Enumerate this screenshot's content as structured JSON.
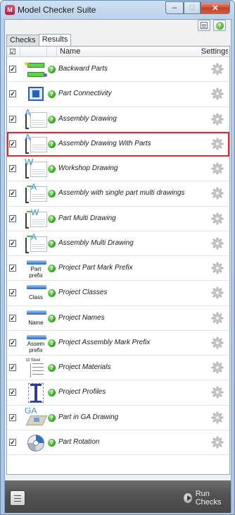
{
  "window": {
    "title": "Model Checker Suite",
    "minimize_glyph": "–",
    "maximize_glyph": "□",
    "close_glyph": "✕"
  },
  "toolbar": {
    "help_glyph": "?"
  },
  "tabs": [
    {
      "label": "Checks",
      "active": false
    },
    {
      "label": "Results",
      "active": true
    }
  ],
  "grid": {
    "header": {
      "check_glyph": "☑",
      "name": "Name",
      "settings": "Settings"
    },
    "check_glyph": "✓",
    "status_glyph": "?",
    "rows": [
      {
        "name": "Backward Parts",
        "checked": true,
        "icon": "backward-parts-icon",
        "selected": false
      },
      {
        "name": "Part Connectivity",
        "checked": true,
        "icon": "part-connectivity-icon",
        "selected": false
      },
      {
        "name": "Assembly Drawing",
        "checked": true,
        "icon": "assembly-drawing-icon",
        "letter": "A",
        "selected": false
      },
      {
        "name": "Assembly Drawing With Parts",
        "checked": true,
        "icon": "assembly-drawing-with-parts-icon",
        "letter": "A",
        "selected": true
      },
      {
        "name": "Workshop Drawing",
        "checked": true,
        "icon": "workshop-drawing-icon",
        "letter": "W",
        "selected": false
      },
      {
        "name": "Assembly with single part multi drawings",
        "checked": true,
        "icon": "assembly-single-part-multi-icon",
        "letter": "A",
        "selected": false
      },
      {
        "name": "Part Multi Drawing",
        "checked": true,
        "icon": "part-multi-drawing-icon",
        "letter": "W",
        "selected": false
      },
      {
        "name": "Assembly Multi Drawing",
        "checked": true,
        "icon": "assembly-multi-drawing-icon",
        "letter": "A",
        "selected": false
      },
      {
        "name": "Project Part Mark Prefix",
        "checked": true,
        "icon": "project-part-mark-prefix-icon",
        "caption": "Part\nprefix",
        "selected": false
      },
      {
        "name": "Project Classes",
        "checked": true,
        "icon": "project-classes-icon",
        "caption": "Class",
        "selected": false
      },
      {
        "name": "Project Names",
        "checked": true,
        "icon": "project-names-icon",
        "caption": "Name",
        "selected": false
      },
      {
        "name": "Project Assembly Mark Prefix",
        "checked": true,
        "icon": "project-assembly-mark-prefix-icon",
        "caption": "Assem\nprefix",
        "selected": false
      },
      {
        "name": "Project Materials",
        "checked": true,
        "icon": "project-materials-icon",
        "selected": false
      },
      {
        "name": "Project Profiles",
        "checked": true,
        "icon": "project-profiles-icon",
        "selected": false
      },
      {
        "name": "Part in GA Drawing",
        "checked": true,
        "icon": "part-in-ga-drawing-icon",
        "letter": "GA",
        "selected": false
      },
      {
        "name": "Part Rotation",
        "checked": true,
        "icon": "part-rotation-icon",
        "selected": false
      }
    ]
  },
  "footer": {
    "run_checks_label": "Run Checks"
  },
  "colors": {
    "selection_outline": "#e22a2a",
    "status_ok": "#2f9b1f",
    "footer_bg": "#545454"
  }
}
